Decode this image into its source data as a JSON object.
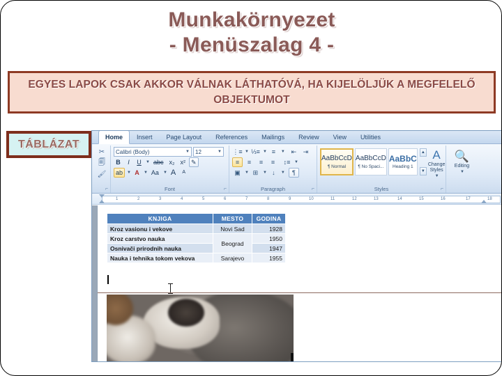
{
  "slide": {
    "title_line1": "Munkakörnyezet",
    "title_line2": "- Menüszalag 4 -",
    "banner_text": "EGYES LAPOK CSAK AKKOR VÁLNAK LÁTHATÓVÁ, HA KIJELÖLJÜK A MEGFELELŐ OBJEKTUMOT",
    "callout_label": "TÁBLÁZAT",
    "colors": {
      "title_text": "#8A5A57",
      "banner_fill": "#F8DCD0",
      "banner_border": "#8E3A24",
      "callout_fill": "#D6F2F2",
      "callout_border": "#7E2E1C",
      "slide_border": "#000000",
      "table_header_fill": "#4F81BD"
    }
  },
  "word": {
    "tabs": [
      {
        "label": "Home",
        "active": true
      },
      {
        "label": "Insert",
        "active": false
      },
      {
        "label": "Page Layout",
        "active": false
      },
      {
        "label": "References",
        "active": false
      },
      {
        "label": "Mailings",
        "active": false
      },
      {
        "label": "Review",
        "active": false
      },
      {
        "label": "View",
        "active": false
      },
      {
        "label": "Utilities",
        "active": false
      }
    ],
    "groups": {
      "clipboard": {
        "label": "",
        "items": [
          "cut-icon",
          "copy-icon",
          "format-painter-icon"
        ]
      },
      "font": {
        "label": "Font",
        "font_name": "Calibri (Body)",
        "font_size": "12",
        "bold": "B",
        "italic": "I",
        "underline": "U",
        "strikethrough": "abc",
        "subscript": "x₂",
        "superscript": "x²",
        "clear_format": "Aa",
        "highlight": "ab",
        "font_color": "A",
        "change_case": "Aa",
        "grow_font": "A",
        "shrink_font": "A"
      },
      "paragraph": {
        "label": "Paragraph",
        "bullets": "⋮≡",
        "numbering": "⅓≡",
        "multilevel": "≡",
        "decrease_indent": "⇤",
        "increase_indent": "⇥",
        "align_left": "≡",
        "align_center": "≡",
        "align_right": "≡",
        "justify": "≡",
        "line_spacing": "↕≡",
        "shading": "▣",
        "borders": "⊞",
        "sort": "↓",
        "show_marks": "¶"
      },
      "styles": {
        "label": "Styles",
        "cards": [
          {
            "sample": "AaBbCcD",
            "name": "¶ Normal",
            "selected": true
          },
          {
            "sample": "AaBbCcD",
            "name": "¶ No Spaci...",
            "selected": false
          },
          {
            "sample": "AaBbC",
            "name": "Heading 1",
            "selected": false
          }
        ],
        "change_styles": "Change\nStyles"
      },
      "editing": {
        "label": "",
        "button": "Editing"
      }
    },
    "ruler": {
      "ticks": [
        "1",
        "2",
        "3",
        "4",
        "5",
        "6",
        "7",
        "8",
        "9",
        "10",
        "11",
        "12",
        "13",
        "14",
        "15",
        "16",
        "17",
        "18"
      ]
    },
    "document": {
      "table": {
        "headers": [
          "KNJIGA",
          "MESTO",
          "GODINA"
        ],
        "rows": [
          {
            "knjiga": "Kroz vasionu i vekove",
            "mesto": "Novi Sad",
            "godina": "1928"
          },
          {
            "knjiga": "Kroz carstvo nauka",
            "mesto": "Beograd",
            "godina": "1950"
          },
          {
            "knjiga": "Osnivači prirodnih nauka",
            "mesto": "",
            "godina": "1947"
          },
          {
            "knjiga": "Nauka i tehnika tokom vekova",
            "mesto": "Sarajevo",
            "godina": "1955"
          }
        ]
      }
    }
  }
}
